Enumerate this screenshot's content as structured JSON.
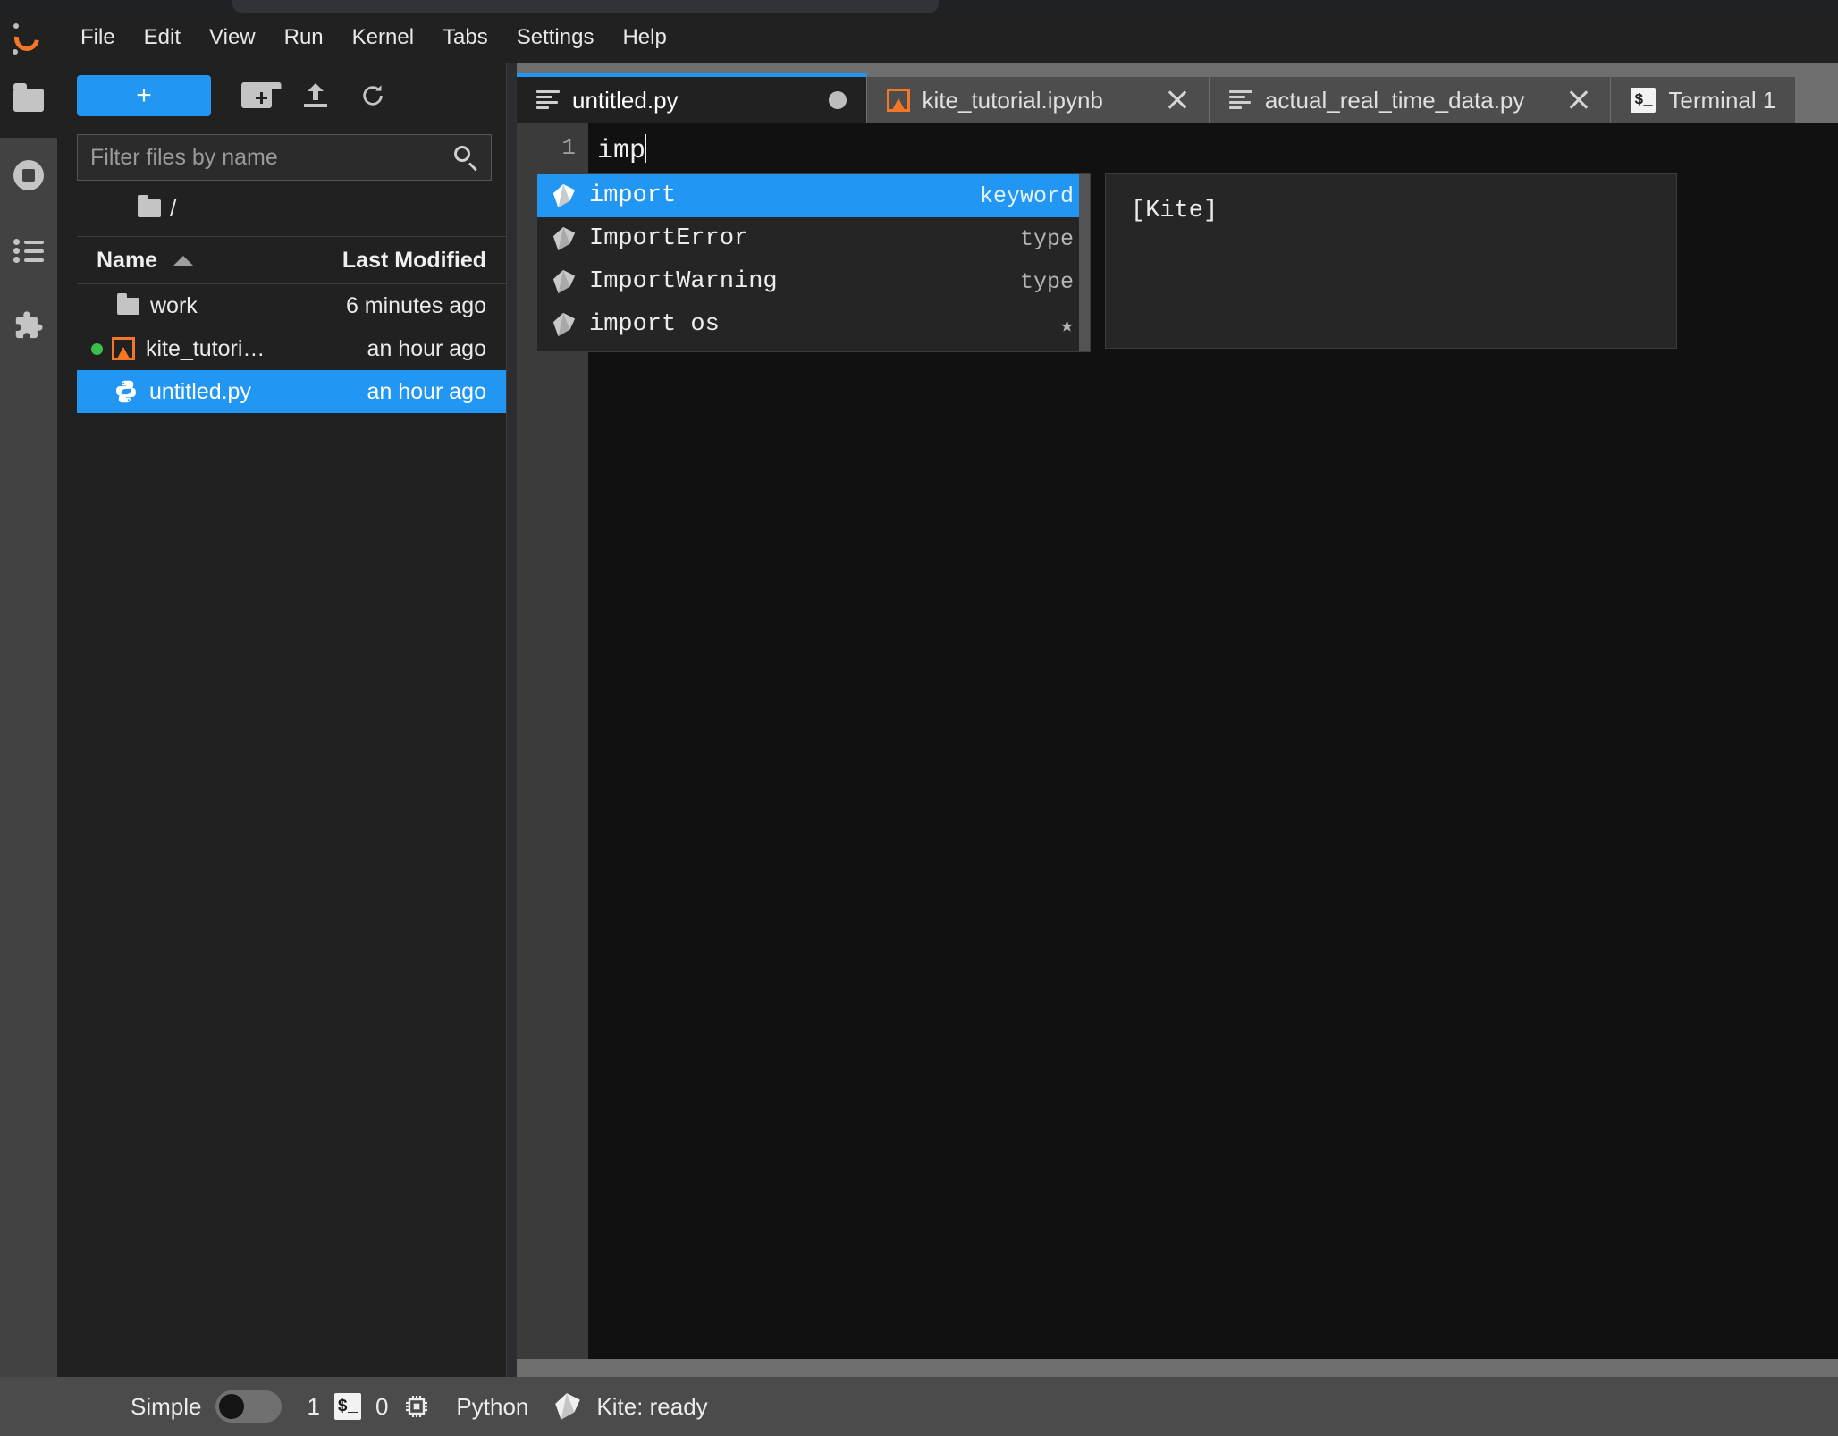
{
  "app": {
    "title": "JupyterLab",
    "logo_icon": "jupyter-logo"
  },
  "menubar": {
    "items": [
      {
        "label": "File"
      },
      {
        "label": "Edit"
      },
      {
        "label": "View"
      },
      {
        "label": "Run"
      },
      {
        "label": "Kernel"
      },
      {
        "label": "Tabs"
      },
      {
        "label": "Settings"
      },
      {
        "label": "Help"
      }
    ]
  },
  "activity_bar": {
    "items": [
      {
        "name": "file-browser",
        "icon": "folder-icon",
        "active": true
      },
      {
        "name": "running-sessions",
        "icon": "stop-circle-icon",
        "active": false
      },
      {
        "name": "commands",
        "icon": "list-icon",
        "active": false
      },
      {
        "name": "extension-manager",
        "icon": "puzzle-icon",
        "active": false
      }
    ]
  },
  "file_browser": {
    "toolbar": {
      "new_launcher_label": "+",
      "new_folder_icon": "new-folder-icon",
      "upload_icon": "upload-icon",
      "refresh_icon": "refresh-icon"
    },
    "filter": {
      "placeholder": "Filter files by name",
      "value": "",
      "icon": "search-icon"
    },
    "breadcrumb": {
      "root": "/",
      "icon": "folder-icon"
    },
    "columns": {
      "name": "Name",
      "last_modified": "Last Modified",
      "sort": "ascending"
    },
    "rows": [
      {
        "name": "work",
        "modified": "6 minutes ago",
        "icon": "folder-icon",
        "running": false,
        "selected": false
      },
      {
        "name": "kite_tutori…",
        "modified": "an hour ago",
        "icon": "notebook-icon",
        "running": true,
        "selected": false
      },
      {
        "name": "untitled.py",
        "modified": "an hour ago",
        "icon": "python-icon",
        "running": false,
        "selected": true
      }
    ]
  },
  "tabs": [
    {
      "label": "untitled.py",
      "icon": "text-file-icon",
      "active": true,
      "dirty": true,
      "closable": false
    },
    {
      "label": "kite_tutorial.ipynb",
      "icon": "notebook-icon",
      "active": false,
      "dirty": false,
      "closable": true
    },
    {
      "label": "actual_real_time_data.py",
      "icon": "text-file-icon",
      "active": false,
      "dirty": false,
      "closable": true
    },
    {
      "label": "Terminal 1",
      "icon": "terminal-icon",
      "active": false,
      "dirty": false,
      "closable": false
    }
  ],
  "editor": {
    "line_number": "1",
    "code": "imp",
    "language": "Python"
  },
  "completer": {
    "items": [
      {
        "label": "import",
        "type": "keyword",
        "icon": "kite-icon",
        "selected": true
      },
      {
        "label": "ImportError",
        "type": "type",
        "icon": "kite-icon",
        "selected": false
      },
      {
        "label": "ImportWarning",
        "type": "type",
        "icon": "kite-icon",
        "selected": false
      },
      {
        "label": "import os",
        "type": "★",
        "icon": "kite-icon",
        "selected": false
      }
    ],
    "documentation": "[Kite]"
  },
  "status_bar": {
    "mode_label": "Simple",
    "mode_enabled": false,
    "terminal_count": "1",
    "terminal_icon": "terminal-icon",
    "kernel_count": "0",
    "kernel_icon": "chip-icon",
    "kernel_name": "Python",
    "kite_icon": "kite-icon",
    "kite_status": "Kite: ready"
  },
  "colors": {
    "accent": "#2196f3",
    "jupyter_orange": "#f37726",
    "running_green": "#3ac04a",
    "editor_background": "#111111",
    "panel_background": "#212121",
    "dock_background": "#6e6e6e"
  }
}
